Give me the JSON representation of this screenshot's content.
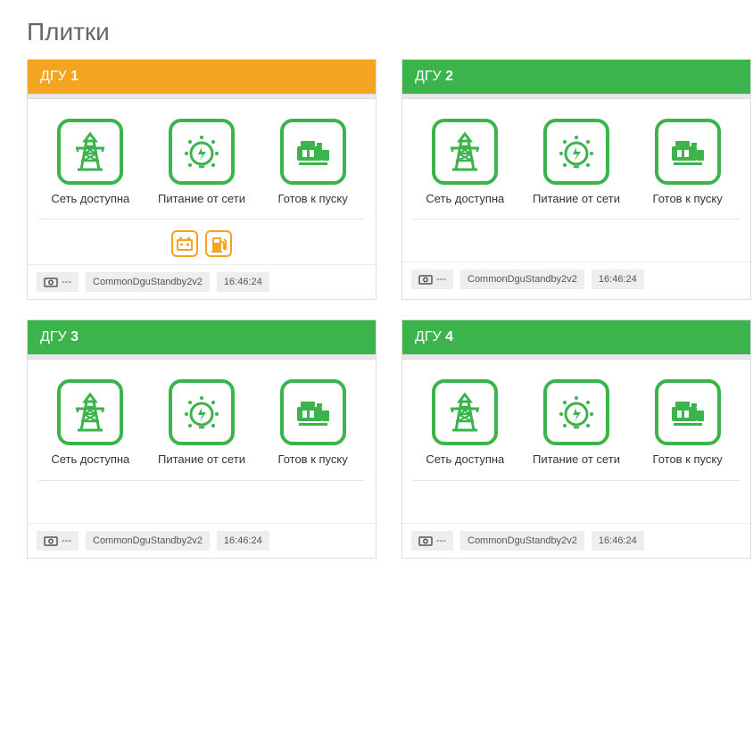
{
  "page_title": "Плитки",
  "colors": {
    "green": "#3bb44b",
    "orange": "#f4a421"
  },
  "status_labels": {
    "net": "Сеть доступна",
    "power": "Питание от сети",
    "ready": "Готов к пуску"
  },
  "tiles": [
    {
      "title_prefix": "ДГУ",
      "title_num": "1",
      "header_color": "orange",
      "warnings": [
        "battery",
        "fuel"
      ],
      "footer": {
        "money": "---",
        "layout": "CommonDguStandby2v2",
        "time": "16:46:24"
      }
    },
    {
      "title_prefix": "ДГУ",
      "title_num": "2",
      "header_color": "green",
      "warnings": [],
      "footer": {
        "money": "---",
        "layout": "CommonDguStandby2v2",
        "time": "16:46:24"
      }
    },
    {
      "title_prefix": "ДГУ",
      "title_num": "3",
      "header_color": "green",
      "warnings": [],
      "footer": {
        "money": "---",
        "layout": "CommonDguStandby2v2",
        "time": "16:46:24"
      }
    },
    {
      "title_prefix": "ДГУ",
      "title_num": "4",
      "header_color": "green",
      "warnings": [],
      "footer": {
        "money": "---",
        "layout": "CommonDguStandby2v2",
        "time": "16:46:24"
      }
    }
  ]
}
